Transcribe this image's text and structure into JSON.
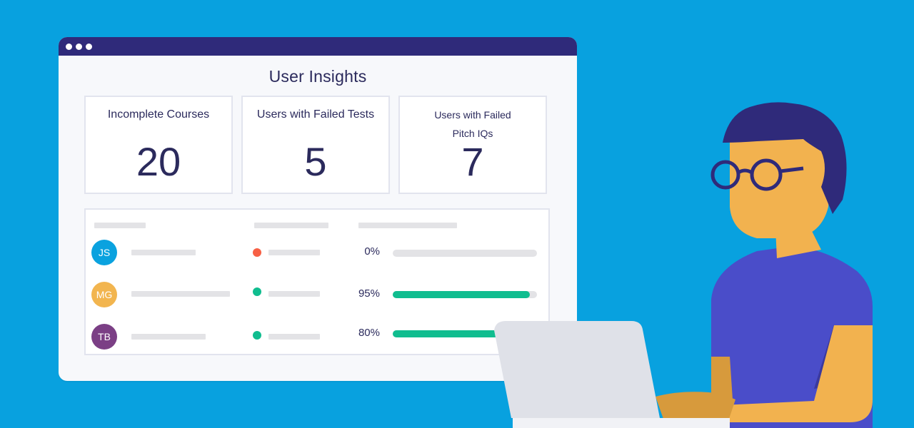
{
  "page_title": "User Insights",
  "cards": [
    {
      "label": "Incomplete Courses",
      "value": "20"
    },
    {
      "label": "Users with Failed Tests",
      "value": "5"
    },
    {
      "label_line1": "Users with Failed",
      "label_line2": "Pitch IQs",
      "value": "7"
    }
  ],
  "rows": [
    {
      "initials": "JS",
      "avatar_color": "#0aa2df",
      "status_color": "#f76045",
      "percent_label": "0%",
      "progress": 0
    },
    {
      "initials": "MG",
      "avatar_color": "#f2b54f",
      "status_color": "#10bd8f",
      "percent_label": "95%",
      "progress": 0.95
    },
    {
      "initials": "TB",
      "avatar_color": "#7b3f85",
      "status_color": "#10bd8f",
      "percent_label": "80%",
      "progress": 0.8
    }
  ],
  "colors": {
    "background": "#08a1df",
    "titlebar": "#2f2a7a",
    "progress_fill": "#10bd8f"
  }
}
